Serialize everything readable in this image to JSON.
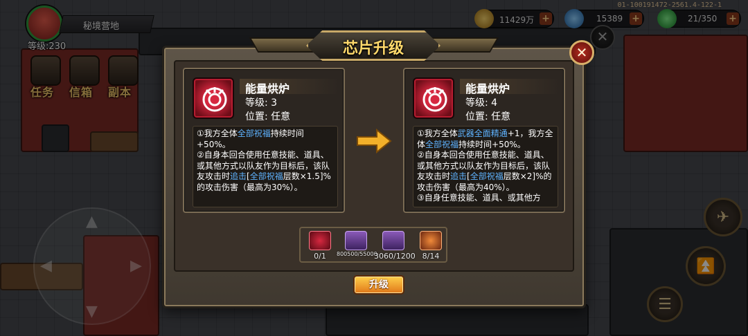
{
  "hud": {
    "player_level": "等级:230",
    "location": "秘境营地",
    "build_id": "01-100191472-2561.4-122-1",
    "resources": [
      {
        "name": "gold",
        "value": "11429万",
        "color": "#d9a441"
      },
      {
        "name": "gem",
        "value": "15389",
        "color": "#3a9ae8"
      },
      {
        "name": "energy",
        "value": "21/350",
        "color": "#2fb84a"
      }
    ],
    "side_menu": [
      "任务",
      "信箱",
      "副本"
    ]
  },
  "dialog": {
    "title": "芯片升级",
    "close_icon": "close-icon",
    "current": {
      "name": "能量烘炉",
      "level": "等级: 3",
      "position": "位置: 任意",
      "desc": [
        {
          "t": "①我方全体",
          "h": false
        },
        {
          "t": "全部祝福",
          "h": true
        },
        {
          "t": "持续时间+50%。",
          "h": false
        },
        {
          "t": "\n②自身本回合使用任意技能、道具、或其他方式以队友作为目标后，该队友攻击时",
          "h": false
        },
        {
          "t": "追击",
          "h": true
        },
        {
          "t": "[",
          "h": false
        },
        {
          "t": "全部祝福",
          "h": true
        },
        {
          "t": "层数×1.5]%的攻击伤害（最高为30%）。",
          "h": false
        }
      ]
    },
    "next": {
      "name": "能量烘炉",
      "level": "等级: 4",
      "position": "位置: 任意",
      "desc": [
        {
          "t": "①我方全体",
          "h": false
        },
        {
          "t": "武器全面精通",
          "h": true
        },
        {
          "t": "+1，我方全体",
          "h": false
        },
        {
          "t": "全部祝福",
          "h": true
        },
        {
          "t": "持续时间+50%。",
          "h": false
        },
        {
          "t": "\n②自身本回合使用任意技能、道具、或其他方式以队友作为目标后，该队友攻击时",
          "h": false
        },
        {
          "t": "追击",
          "h": true
        },
        {
          "t": "[",
          "h": false
        },
        {
          "t": "全部祝福",
          "h": true
        },
        {
          "t": "层数×2]%的攻击伤害（最高为40%）。",
          "h": false
        },
        {
          "t": "\n③自身任意技能、道具、或其他方",
          "h": false
        }
      ]
    },
    "costs": [
      {
        "icon": "chip-material-icon",
        "value": "0/1",
        "style": "red"
      },
      {
        "icon": "metal-ingot-icon",
        "value": "800500/55000",
        "style": "purple"
      },
      {
        "icon": "silver-bar-icon",
        "value": "3060/1200",
        "style": "purple"
      },
      {
        "icon": "orange-core-icon",
        "value": "8/14",
        "style": "orange"
      }
    ],
    "upgrade_label": "升级"
  }
}
